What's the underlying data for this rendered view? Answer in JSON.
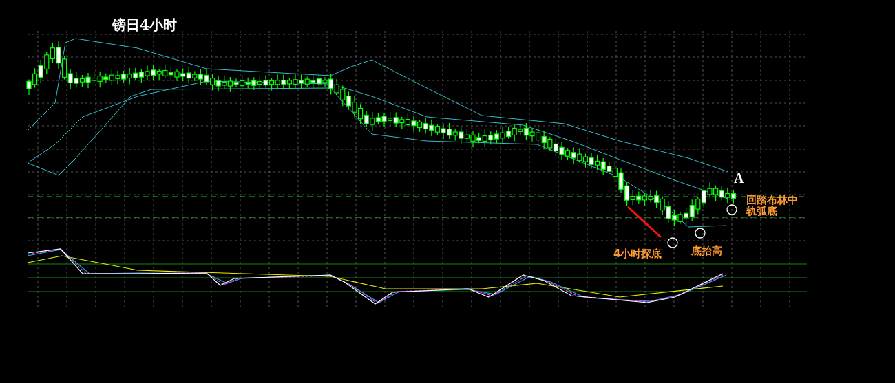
{
  "chart": {
    "title": "镑日4小时"
  },
  "annotations": [
    {
      "kind": "point",
      "text": "A",
      "color": "#ffffff"
    },
    {
      "kind": "note",
      "text": "回踏布林中",
      "color": "#ff9933"
    },
    {
      "kind": "note",
      "text": "轨弧底",
      "color": "#ff9933"
    },
    {
      "kind": "note",
      "text": "4小时探底",
      "color": "#ff9933"
    },
    {
      "kind": "note",
      "text": "底抬高",
      "color": "#ff9933"
    }
  ]
}
